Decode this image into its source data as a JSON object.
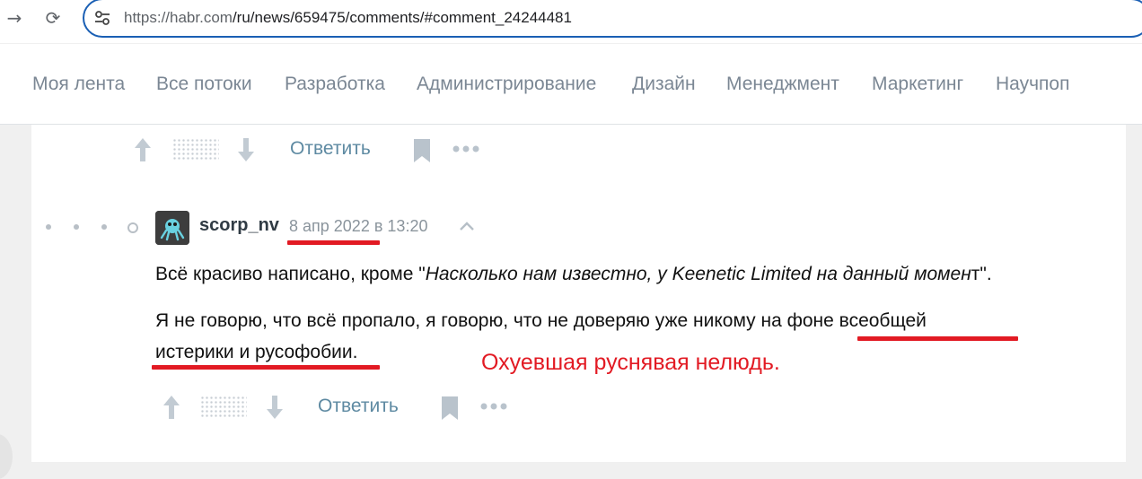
{
  "browser": {
    "url_host": "https://habr.com",
    "url_path": "/ru/news/659475/comments/#comment_24244481"
  },
  "habr_nav": {
    "items": [
      "Моя лента",
      "Все потоки",
      "Разработка",
      "Администрирование",
      "Дизайн",
      "Менеджмент",
      "Маркетинг",
      "Научпоп"
    ]
  },
  "prev_comment_actions": {
    "reply_label": "Ответить"
  },
  "comment": {
    "username": "scorp_nv",
    "date": "8 апр 2022",
    "time_sep": "в",
    "time": "13:20",
    "paragraph1_start": "Всё красиво написано, кроме \"",
    "paragraph1_italic": "Насколько нам известно, у Keenetic Limited на данный момен",
    "paragraph1_end": "т\".",
    "paragraph2_line1": "Я не говорю, что всё пропало, я говорю, что не доверяю уже никому на фоне всеобщей",
    "paragraph2_line2": "истерики и русофобии."
  },
  "comment_actions": {
    "reply_label": "Ответить"
  },
  "annotation": {
    "text": "Охуевшая руснявая нелюдь.",
    "color": "#e21a23"
  },
  "colors": {
    "accent": "#1a5fb4",
    "reply": "#5e8aa2",
    "nav_text": "#7b8794"
  }
}
